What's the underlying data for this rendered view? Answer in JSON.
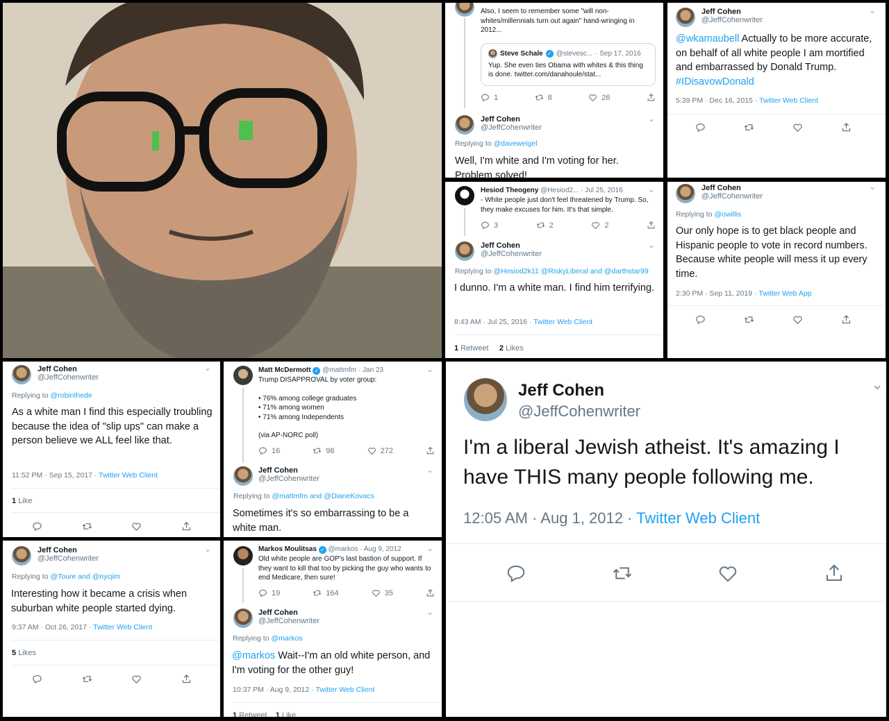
{
  "profile_photo": {
    "alt": ""
  },
  "p1": {
    "top_text": "Also, I seem to remember some \"will non-whites/millennials turn out again\" hand-wringing in 2012...",
    "quote": {
      "name": "Steve Schale",
      "handle": "@stevesc...",
      "date": "· Sep 17, 2016",
      "text": "Yup. She even ties Obama with whites & this thing is done. twitter.com/danahoule/stat..."
    },
    "actions": [
      "1",
      "8",
      "26"
    ],
    "reply": {
      "name": "Jeff Cohen",
      "handle": "@JeffCohenwriter",
      "replying_to": "Replying to",
      "reply_target": "@daveweigel",
      "text": "Well, I'm white and I'm voting for her. Problem solved!"
    }
  },
  "p2": {
    "name": "Jeff Cohen",
    "handle": "@JeffCohenwriter",
    "mention": "@wkamaubell",
    "text": "Actually to be more accurate, on behalf of all white people I am mortified and embarrassed by Donald Trump.",
    "hashtag": "#IDisavowDonald",
    "time": "5:39 PM · Dec 16, 2015 ·",
    "client": "Twitter Web Client"
  },
  "p3": {
    "top": {
      "name": "Hesiod Theogeny",
      "handle": "@Hesiod2...",
      "date": "· Jul 25, 2016",
      "text": "- White people just don't feel threatened by Trump. So, they make excuses for him. It's that simple.",
      "actions": [
        "3",
        "2",
        "2"
      ]
    },
    "reply": {
      "name": "Jeff Cohen",
      "handle": "@JeffCohenwriter",
      "replying_to": "Replying to",
      "targets": "@Hesiod2k11 @RiskyLiberal and @darthstar99",
      "text": "I dunno. I'm a white man. I find him terrifying.",
      "time": "8:43 AM · Jul 25, 2016 ·",
      "client": "Twitter Web Client",
      "retweets": "1",
      "retweets_label": "Retweet",
      "likes": "2",
      "likes_label": "Likes"
    }
  },
  "p4": {
    "name": "Jeff Cohen",
    "handle": "@JeffCohenwriter",
    "replying_to": "Replying to",
    "target": "@owillis",
    "text": "Our only hope is to get black people and Hispanic people to vote in record numbers. Because white people will mess it up every time.",
    "time": "2:30 PM · Sep 11, 2019 ·",
    "client": "Twitter Web App"
  },
  "p5": {
    "name": "Jeff Cohen",
    "handle": "@JeffCohenwriter",
    "replying_to": "Replying to",
    "target": "@robinthede",
    "text": "As a white man I find this especially troubling because the idea of \"slip ups\" can make a person believe we ALL feel like that.",
    "time": "11:52 PM · Sep 15, 2017 ·",
    "client": "Twitter Web Client",
    "likes": "1",
    "likes_label": "Like"
  },
  "p6": {
    "top": {
      "name": "Matt McDermott",
      "handle": "@mattmfm",
      "date": "· Jan 23",
      "line1": "Trump DISAPPROVAL by voter group:",
      "b1": "• 76% among college graduates",
      "b2": "• 71% among women",
      "b3": "• 71% among Independents",
      "src": "(via AP-NORC poll)",
      "actions": [
        "16",
        "98",
        "272"
      ]
    },
    "reply": {
      "name": "Jeff Cohen",
      "handle": "@JeffCohenwriter",
      "replying_to": "Replying to",
      "targets": "@mattmfm and @DianeKovacs",
      "text": "Sometimes it's so embarrassing to be a white man."
    }
  },
  "p7": {
    "name": "Jeff Cohen",
    "handle": "@JeffCohenwriter",
    "replying_to": "Replying to",
    "target": "@Toure and @nycjim",
    "text": "Interesting how it became a crisis when suburban white people started dying.",
    "time": "9:37 AM · Oct 26, 2017 ·",
    "client": "Twitter Web Client",
    "likes": "5",
    "likes_label": "Likes"
  },
  "p8": {
    "top": {
      "name": "Markos Moulitsas",
      "handle": "@markos",
      "date": "· Aug 9, 2012",
      "text": "Old white people are GOP's last bastion of support. If they want to kill that too by picking the guy who wants to end Medicare, then sure!",
      "actions": [
        "19",
        "164",
        "35"
      ]
    },
    "reply": {
      "name": "Jeff Cohen",
      "handle": "@JeffCohenwriter",
      "replying_to": "Replying to",
      "target": "@markos",
      "mention": "@markos",
      "text": "Wait--I'm an old white person, and I'm voting for the other guy!",
      "time": "10:37 PM · Aug 9, 2012 ·",
      "client": "Twitter Web Client",
      "retweets": "1",
      "retweets_label": "Retweet",
      "likes": "1",
      "likes_label": "Like"
    }
  },
  "p9": {
    "name": "Jeff Cohen",
    "handle": "@JeffCohenwriter",
    "text": "I'm a liberal Jewish atheist. It's amazing I have THIS many people following me.",
    "time": "12:05 AM · Aug 1, 2012 ·",
    "client": "Twitter Web Client"
  },
  "colors": {
    "link": "#1da1f2",
    "muted": "#657786",
    "text": "#14171a",
    "separator": "#000000"
  },
  "icons": [
    "reply-icon",
    "retweet-icon",
    "like-icon",
    "share-icon",
    "verified-icon",
    "chevron-down-icon"
  ]
}
